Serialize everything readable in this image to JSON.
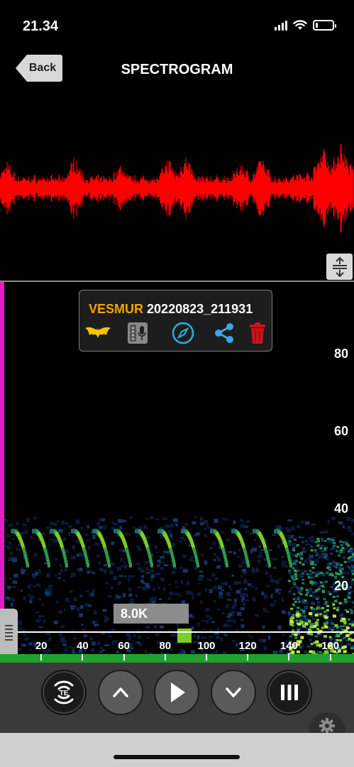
{
  "status_bar": {
    "time": "21.34",
    "battery_level": 0.25
  },
  "nav": {
    "back_label": "Back",
    "title": "SPECTROGRAM"
  },
  "recording": {
    "species": "VESMUR",
    "filename": "20220823_211931"
  },
  "info_icons": [
    "bat-icon",
    "recorder-icon",
    "compass-icon",
    "share-icon",
    "trash-icon"
  ],
  "spectrogram": {
    "y_labels": [
      "80",
      "60",
      "40",
      "20"
    ],
    "x_labels": [
      "20",
      "40",
      "60",
      "80",
      "100",
      "120",
      "140",
      "160"
    ],
    "frequency_marker": "8.0K"
  },
  "colors": {
    "waveform": "#ff0000",
    "species": "#f0a400",
    "playhead": "#e01ec8",
    "timeline": "#22a02e",
    "compass": "#2ab0e0",
    "share": "#3aa6e6",
    "trash": "#c8141a"
  },
  "toolbar": {
    "te_label": "TE",
    "buttons": [
      "te-button",
      "scroll-up-button",
      "play-button",
      "scroll-down-button",
      "pause-button"
    ]
  }
}
